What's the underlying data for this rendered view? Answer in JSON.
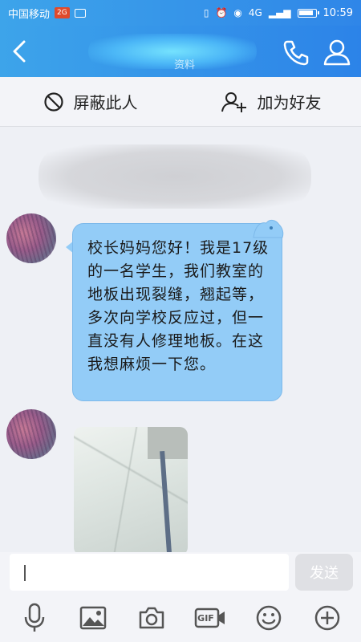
{
  "status": {
    "carrier": "中国移动",
    "badge": "2G",
    "time": "10:59",
    "network": "4G"
  },
  "header": {
    "subtitle": "资料",
    "back_icon": "chevron-left-icon",
    "phone_icon": "phone-icon",
    "contact_icon": "person-icon"
  },
  "actions": {
    "block_label": "屏蔽此人",
    "add_friend_label": "加为好友"
  },
  "chat": {
    "system_text": "",
    "message_text": "校长妈妈您好！我是17级的一名学生，我们教室的地板出现裂缝，翘起等，多次向学校反应过，但一直没有人修理地板。在这我想麻烦一下您。"
  },
  "input": {
    "value": "",
    "send_label": "发送"
  },
  "toolbar": {
    "gif_label": "GIF",
    "items": [
      "microphone-icon",
      "image-icon",
      "camera-icon",
      "gif-icon",
      "emoji-icon",
      "plus-icon"
    ]
  },
  "colors": {
    "header_bg": "#2f86e8",
    "bubble_bg": "#93ccf7",
    "page_bg": "#eef0f5"
  }
}
